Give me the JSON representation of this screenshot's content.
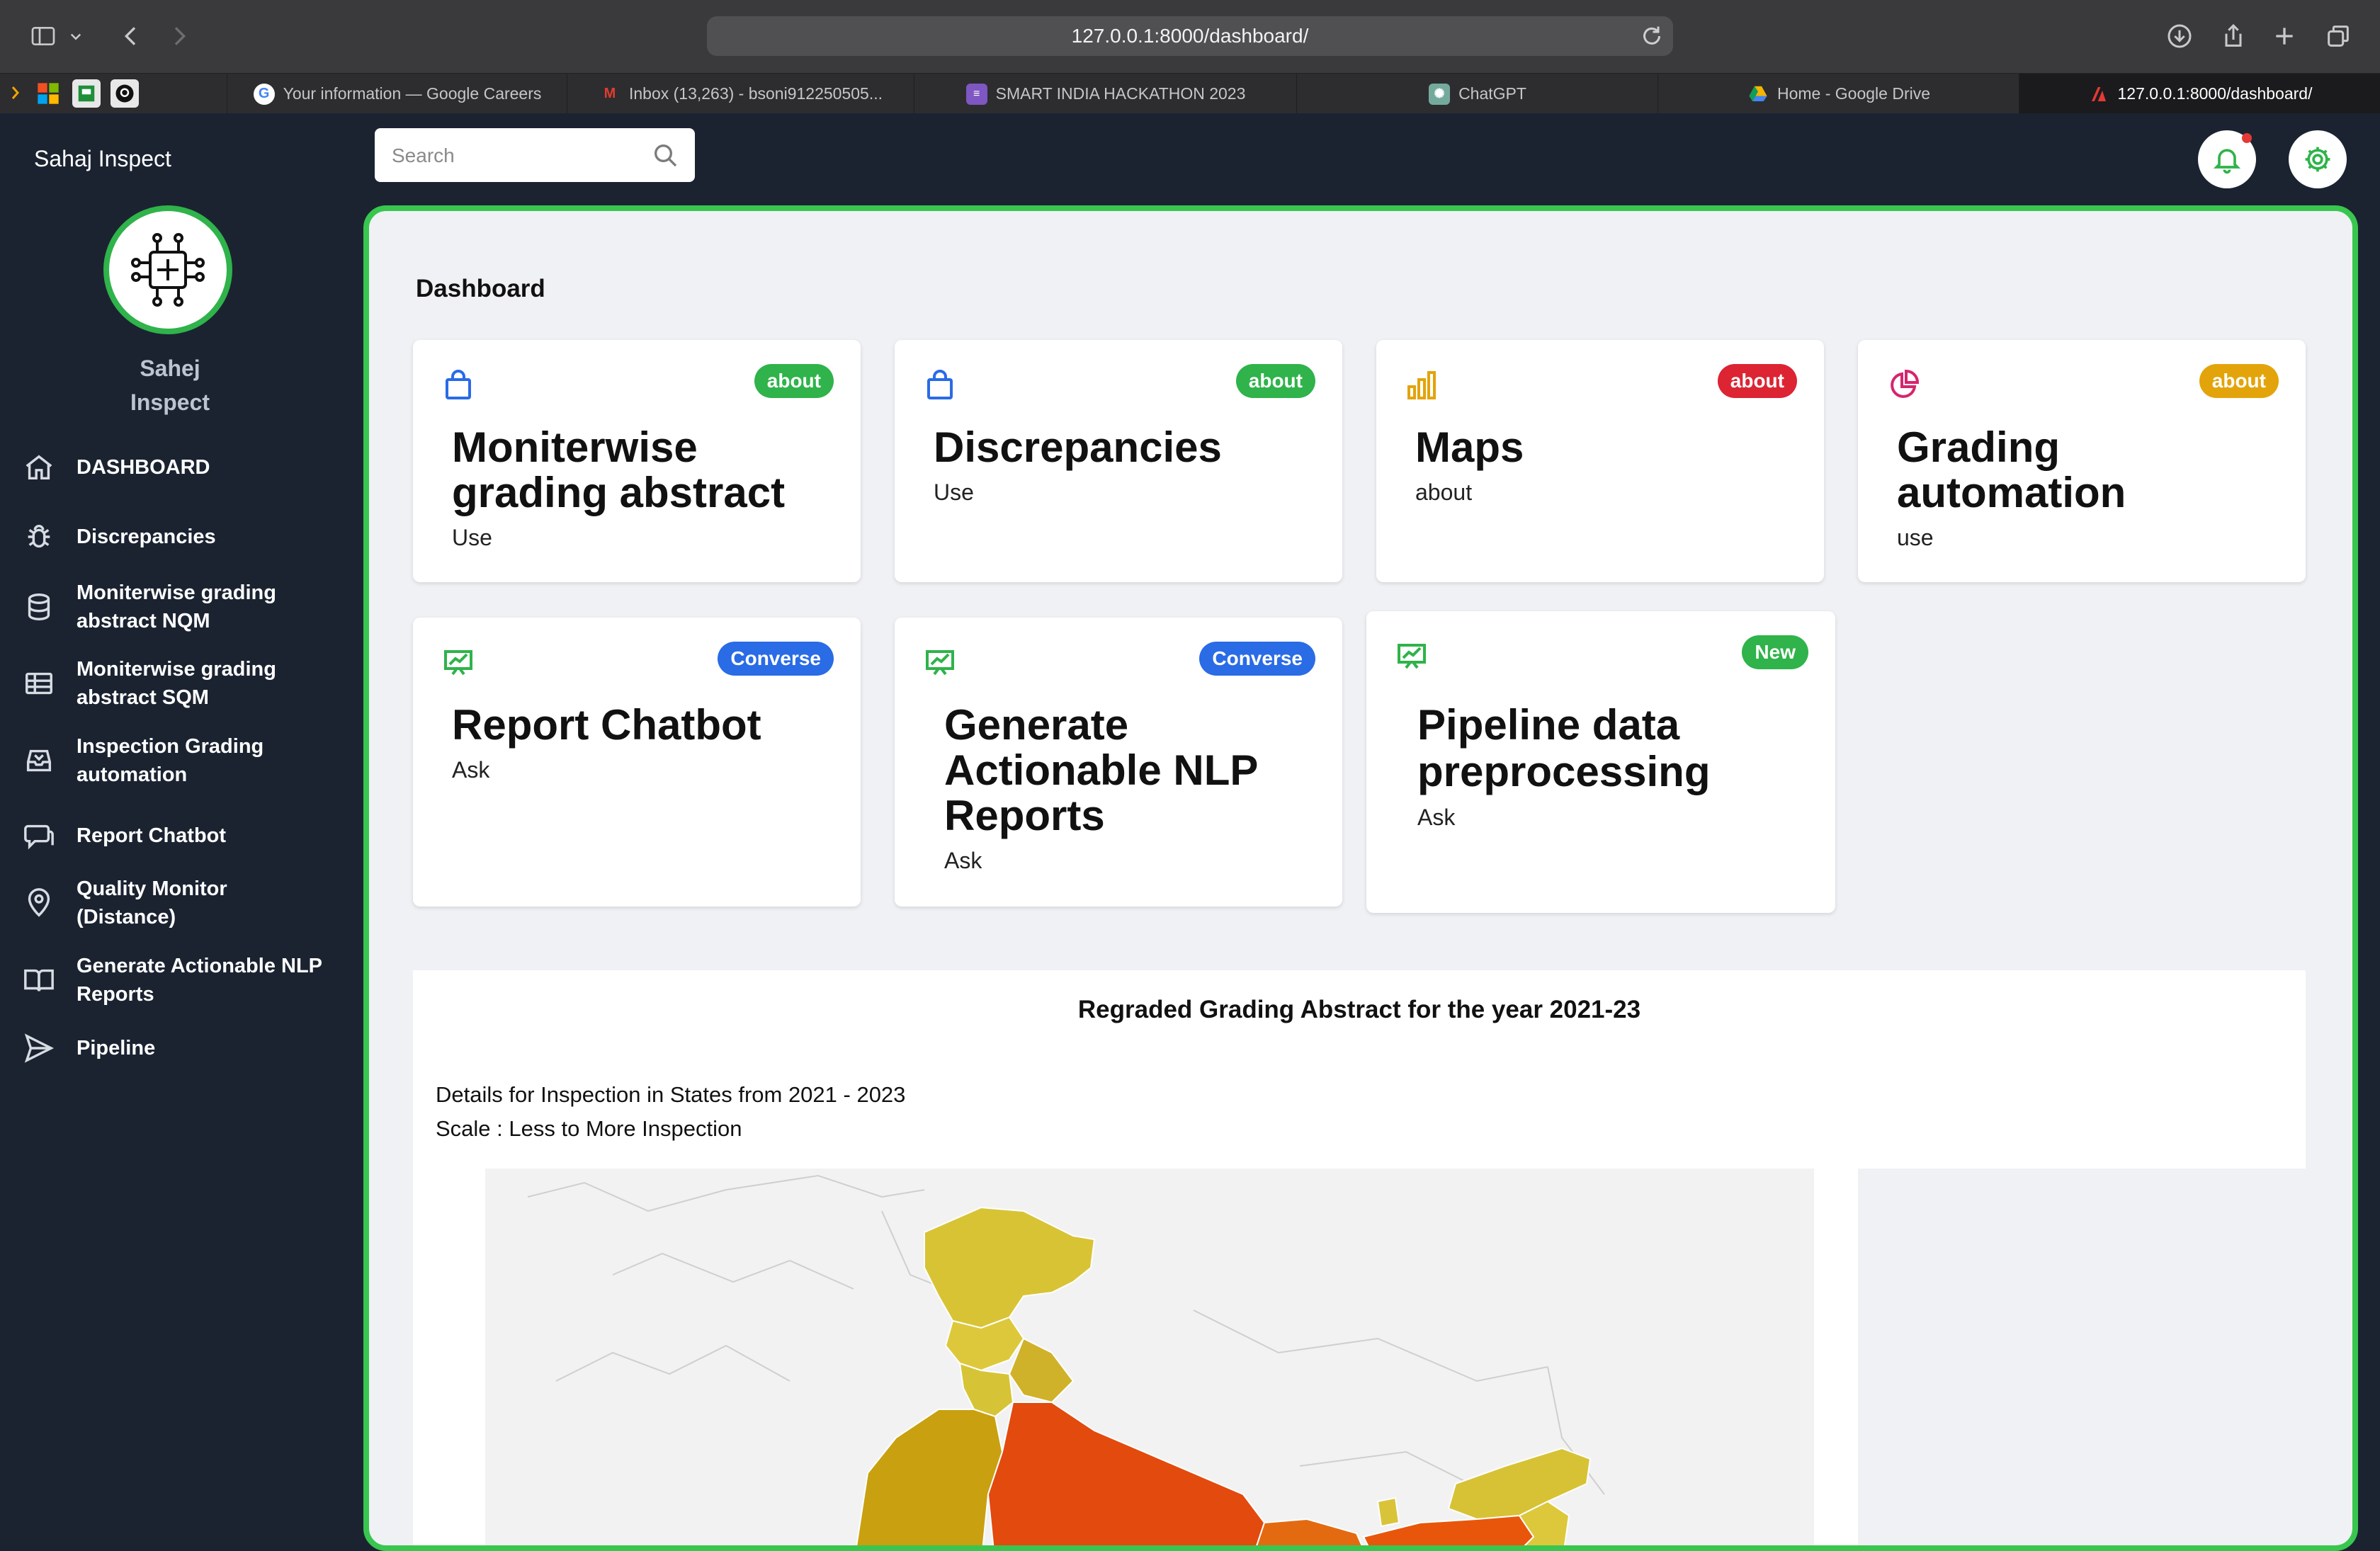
{
  "browser": {
    "url": "127.0.0.1:8000/dashboard/",
    "tabs": [
      {
        "title": "Your information — Google Careers",
        "icon": "google-icon"
      },
      {
        "title": "Inbox (13,263) - bsoni912250505...",
        "icon": "gmail-icon"
      },
      {
        "title": "SMART INDIA HACKATHON 2023",
        "icon": "forms-icon"
      },
      {
        "title": "ChatGPT",
        "icon": "chatgpt-icon"
      },
      {
        "title": "Home - Google Drive",
        "icon": "drive-icon"
      },
      {
        "title": "127.0.0.1:8000/dashboard/",
        "icon": "site-icon",
        "active": true
      }
    ]
  },
  "sidebar": {
    "brand": "Sahaj Inspect",
    "profile_name": "Sahej Inspect",
    "items": [
      {
        "label": "DASHBOARD",
        "icon": "home-icon"
      },
      {
        "label": "Discrepancies",
        "icon": "bug-icon"
      },
      {
        "label": "Moniterwise grading abstract NQM",
        "icon": "database-icon"
      },
      {
        "label": "Moniterwise grading abstract SQM",
        "icon": "table-icon"
      },
      {
        "label": "Inspection Grading automation",
        "icon": "inbox-icon"
      },
      {
        "label": "Report Chatbot",
        "icon": "chat-icon"
      },
      {
        "label": "Quality Monitor (Distance)",
        "icon": "map-pin-icon"
      },
      {
        "label": "Generate Actionable NLP Reports",
        "icon": "book-icon"
      },
      {
        "label": "Pipeline",
        "icon": "send-icon"
      }
    ]
  },
  "header": {
    "search_placeholder": "Search"
  },
  "main": {
    "title": "Dashboard",
    "cards": [
      {
        "title": "Moniterwise grading abstract",
        "subtitle": "Use",
        "badge": "about",
        "badge_color": "#2fb34a",
        "icon": "shopping-bag-icon",
        "icon_color": "#2a6be6"
      },
      {
        "title": "Discrepancies",
        "subtitle": "Use",
        "badge": "about",
        "badge_color": "#2fb34a",
        "icon": "shopping-bag-icon",
        "icon_color": "#2a6be6"
      },
      {
        "title": "Maps",
        "subtitle": "about",
        "badge": "about",
        "badge_color": "#dc2433",
        "icon": "bar-chart-icon",
        "icon_color": "#e3a40b"
      },
      {
        "title": "Grading automation",
        "subtitle": "use",
        "badge": "about",
        "badge_color": "#e3a40b",
        "icon": "pie-chart-icon",
        "icon_color": "#d6256e"
      },
      {
        "title": "Report Chatbot",
        "subtitle": "Ask",
        "badge": "Converse",
        "badge_color": "#2a6be6",
        "icon": "presentation-chart-icon",
        "icon_color": "#2fb34a"
      },
      {
        "title": "Generate Actionable NLP Reports",
        "subtitle": "Ask",
        "badge": "Converse",
        "badge_color": "#2a6be6",
        "icon": "presentation-chart-icon",
        "icon_color": "#2fb34a"
      },
      {
        "title": "Pipeline data preprocessing",
        "subtitle": "Ask",
        "badge": "New",
        "badge_color": "#2fb34a",
        "icon": "presentation-chart-icon",
        "icon_color": "#2fb34a"
      }
    ],
    "map_section": {
      "title": "Regraded Grading Abstract for the year 2021-23",
      "details_line1": "Details for Inspection in States from 2021 - 2023",
      "details_line2": "Scale : Less to More Inspection"
    }
  },
  "colors": {
    "accent": "#38c64f",
    "sidebar_bg": "#1b2331",
    "panel_bg": "#f0f1f5"
  }
}
